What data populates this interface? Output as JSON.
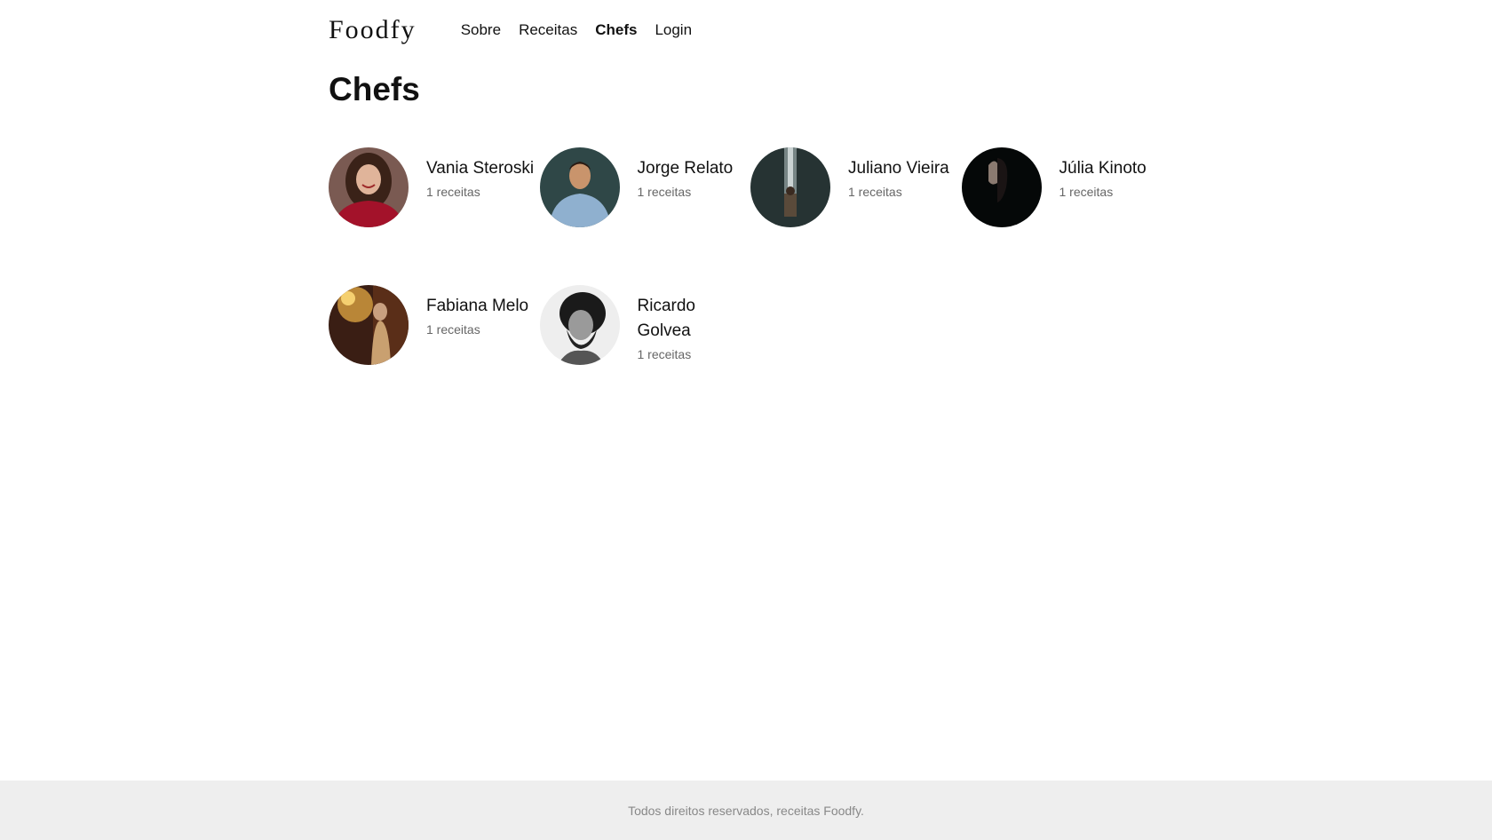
{
  "header": {
    "logo": "Foodfy",
    "nav": [
      {
        "label": "Sobre",
        "active": false
      },
      {
        "label": "Receitas",
        "active": false
      },
      {
        "label": "Chefs",
        "active": true
      },
      {
        "label": "Login",
        "active": false
      }
    ]
  },
  "main": {
    "title": "Chefs",
    "chefs": [
      {
        "name": "Vania Steroski",
        "count": "1 receitas"
      },
      {
        "name": "Jorge Relato",
        "count": "1 receitas"
      },
      {
        "name": "Juliano Vieira",
        "count": "1 receitas"
      },
      {
        "name": "Júlia Kinoto",
        "count": "1 receitas"
      },
      {
        "name": "Fabiana Melo",
        "count": "1 receitas"
      },
      {
        "name": "Ricardo Golvea",
        "count": "1 receitas"
      }
    ]
  },
  "footer": {
    "text": "Todos direitos reservados, receitas Foodfy."
  }
}
